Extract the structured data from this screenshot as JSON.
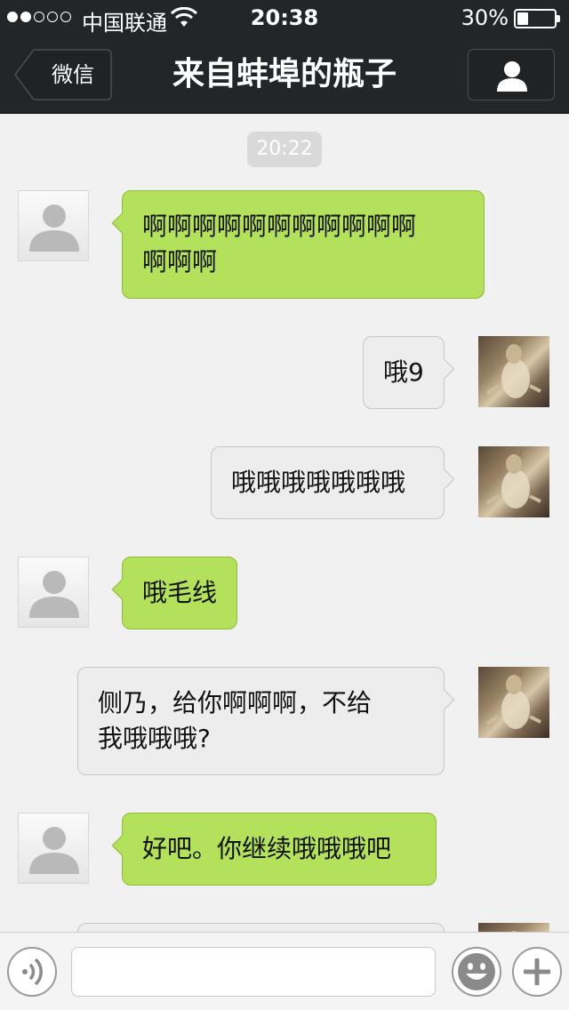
{
  "status_bar": {
    "carrier": "中国联通",
    "time": "20:38",
    "battery": "30%",
    "battery_level": 0.3,
    "signal_bars_filled": 2,
    "signal_bars_total": 5
  },
  "nav": {
    "back_label": "微信",
    "title": "来自蚌埠的瓶子"
  },
  "chat": {
    "timestamp": "20:22",
    "messages": [
      {
        "side": "left",
        "text": "啊啊啊啊啊啊啊啊啊啊啊\n啊啊啊"
      },
      {
        "side": "right",
        "text": "哦9"
      },
      {
        "side": "right",
        "text": "哦哦哦哦哦哦哦"
      },
      {
        "side": "left",
        "text": "哦毛线"
      },
      {
        "side": "right",
        "text": "侧乃，给你啊啊啊，不给\n我哦哦哦?"
      },
      {
        "side": "left",
        "text": "好吧。你继续哦哦哦吧"
      },
      {
        "side": "right",
        "text": ""
      }
    ]
  },
  "input_bar": {
    "voice_icon": "voice-icon",
    "emoji_icon": "emoji-icon",
    "plus_icon": "plus-icon",
    "message_value": ""
  },
  "colors": {
    "bar_bg": "#232628",
    "chat_bg": "#f1f1f1",
    "bubble_green": "#b4e15c",
    "bubble_gray": "#ededed"
  }
}
